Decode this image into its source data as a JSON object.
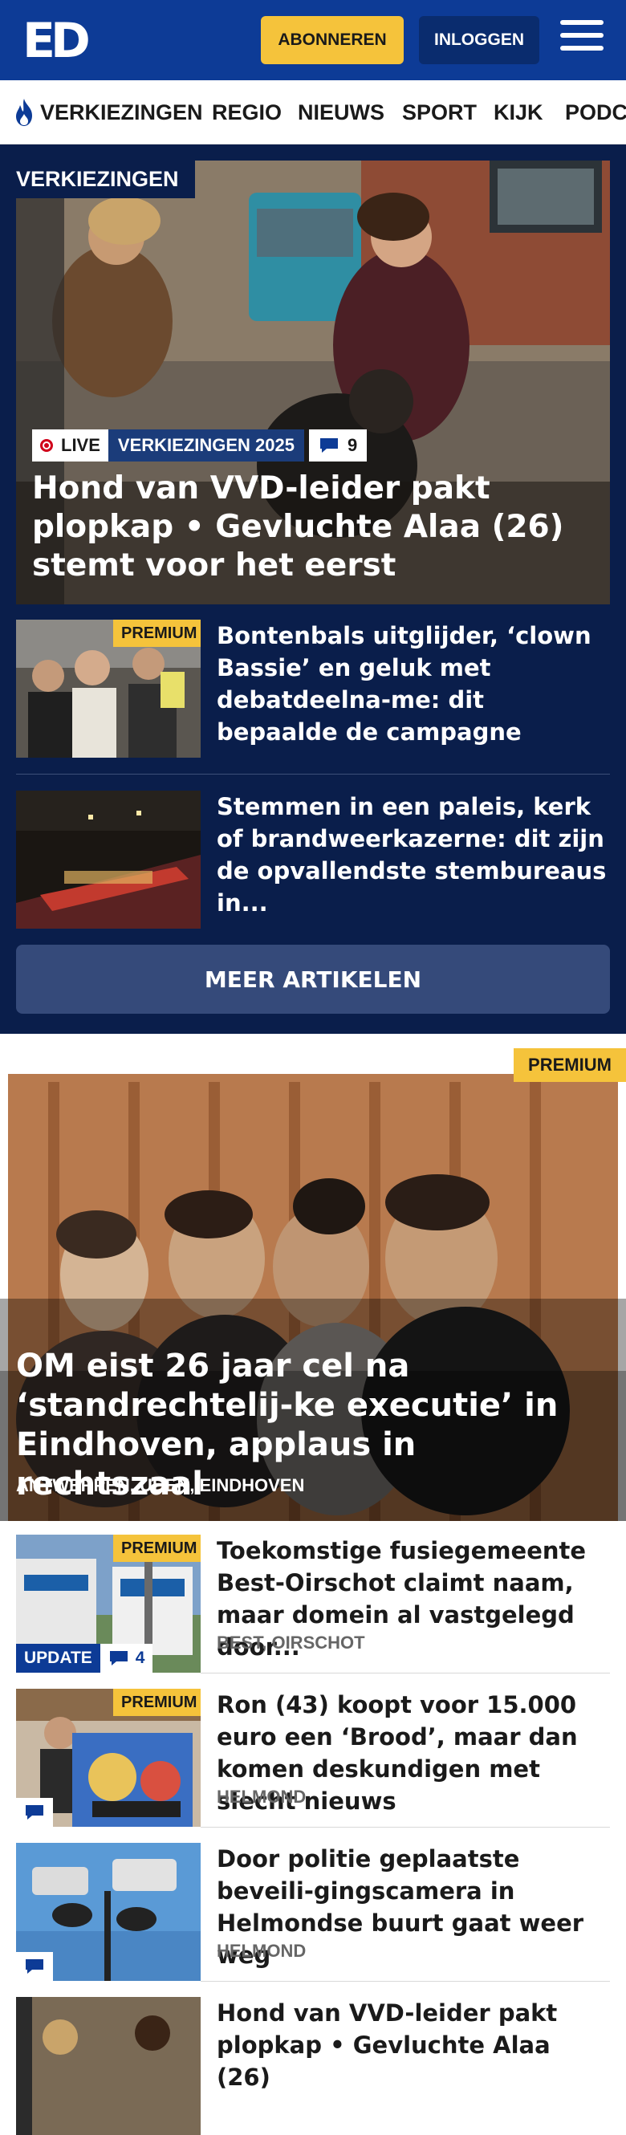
{
  "header": {
    "logo": "ED",
    "subscribe_label": "ABONNEREN",
    "login_label": "INLOGGEN"
  },
  "nav": {
    "items": [
      "VERKIEZINGEN",
      "REGIO",
      "NIEUWS",
      "SPORT",
      "KIJK",
      "PODC"
    ]
  },
  "election": {
    "section_label": "VERKIEZINGEN",
    "hero": {
      "live_label": "LIVE",
      "topic": "VERKIEZINGEN 2025",
      "comment_count": "9",
      "title": "Hond van VVD-leider pakt plopkap • Gevluchte Alaa (26) stemt voor het eerst"
    },
    "articles": [
      {
        "premium": "PREMIUM",
        "title": "Bontenbals uitglijder, ‘clown Bassie’ en geluk met debatdeelna-me: dit bepaalde de campagne"
      },
      {
        "premium": "",
        "title": "Stemmen in een paleis, kerk of brandweerkazerne: dit zijn de opvallendste stembureaus in..."
      }
    ],
    "more_label": "MEER ARTIKELEN"
  },
  "featured": {
    "premium": "PREMIUM",
    "title": "OM eist 26 jaar cel na ‘standrechtelij-ke executie’ in Eindhoven, applaus in rechtszaal",
    "place": "ANTWERPEN, UDEN, EINDHOVEN"
  },
  "list": [
    {
      "premium": "PREMIUM",
      "update": "UPDATE",
      "comments": "4",
      "title": "Toekomstige fusiegemeente Best-Oirschot claimt naam, maar domein al vastgelegd door...",
      "place": "BEST, OIRSCHOT"
    },
    {
      "premium": "PREMIUM",
      "title": "Ron (43) koopt voor 15.000 euro een ‘Brood’, maar dan komen deskundigen met slecht nieuws",
      "place": "HELMOND"
    },
    {
      "premium": "",
      "title": "Door politie geplaatste beveili-gingscamera in Helmondse buurt gaat weer weg",
      "place": "HELMOND"
    },
    {
      "premium": "",
      "title": "Hond van VVD-leider pakt plopkap • Gevluchte Alaa (26)",
      "place": ""
    }
  ],
  "colors": {
    "brand_blue": "#0d3b96",
    "dark_navy": "#0a1e4b",
    "premium_yellow": "#f5c33b",
    "live_red": "#d0021b"
  }
}
